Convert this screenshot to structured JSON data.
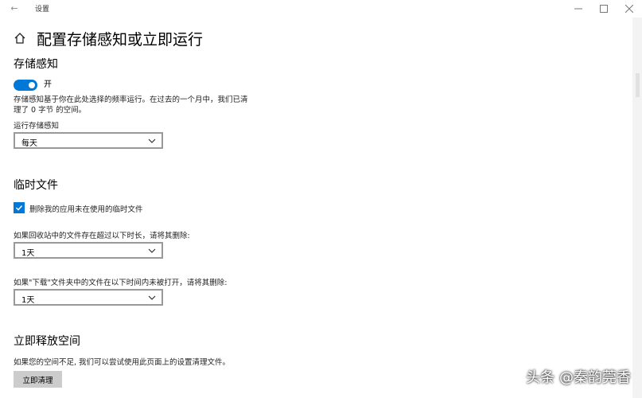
{
  "window": {
    "title": "设置",
    "back_glyph": "←",
    "minimize_glyph": "—",
    "maximize_glyph": "☐",
    "close_glyph": "✕"
  },
  "header": {
    "icon": "home-icon",
    "title": "配置存储感知或立即运行"
  },
  "storage_sense": {
    "title": "存储感知",
    "toggle": {
      "state": "on",
      "label": "开"
    },
    "description_line1": "存储感知基于你在此处选择的频率运行。在过去的一个月中，我们已清",
    "description_line2": "理了 0 字节 的空间。",
    "run_label": "运行存储感知",
    "run_selected": "每天"
  },
  "temp_files": {
    "title": "临时文件",
    "checkbox": {
      "checked": true,
      "label": "删除我的应用未在使用的临时文件"
    },
    "recycle_label": "如果回收站中的文件存在超过以下时长，请将其删除:",
    "recycle_selected": "1天",
    "downloads_label": "如果\"下载\"文件夹中的文件在以下时间内未被打开，请将其删除:",
    "downloads_selected": "1天"
  },
  "free_space": {
    "title": "立即释放空间",
    "description": "如果您的空间不足, 我们可以尝试使用此页面上的设置清理文件。",
    "button_label": "立即清理"
  },
  "watermark": "头条 @秦韵莞香",
  "colors": {
    "accent": "#0078d7",
    "button_bg": "#cccccc",
    "dropdown_border": "#999999"
  }
}
